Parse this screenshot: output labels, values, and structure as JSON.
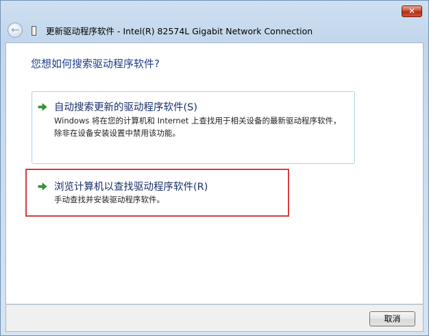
{
  "window": {
    "title": "更新驱动程序软件 - Intel(R) 82574L Gigabit Network Connection",
    "close_label": "✕",
    "back_label": "←"
  },
  "main": {
    "question": "您想如何搜索驱动程序软件?",
    "options": [
      {
        "title": "自动搜索更新的驱动程序软件(S)",
        "description": "Windows 将在您的计算机和 Internet 上查找用于相关设备的最新驱动程序软件，除非在设备安装设置中禁用该功能。",
        "icon": "green-arrow-icon"
      },
      {
        "title": "浏览计算机以查找驱动程序软件(R)",
        "description": "手动查找并安装驱动程序软件。",
        "icon": "green-arrow-icon"
      }
    ]
  },
  "footer": {
    "cancel_label": "取消"
  },
  "colors": {
    "heading": "#1e3c8c",
    "option_title": "#1a2f6a",
    "highlight_border": "#d93a3a",
    "arrow": "#2e9a2e"
  }
}
